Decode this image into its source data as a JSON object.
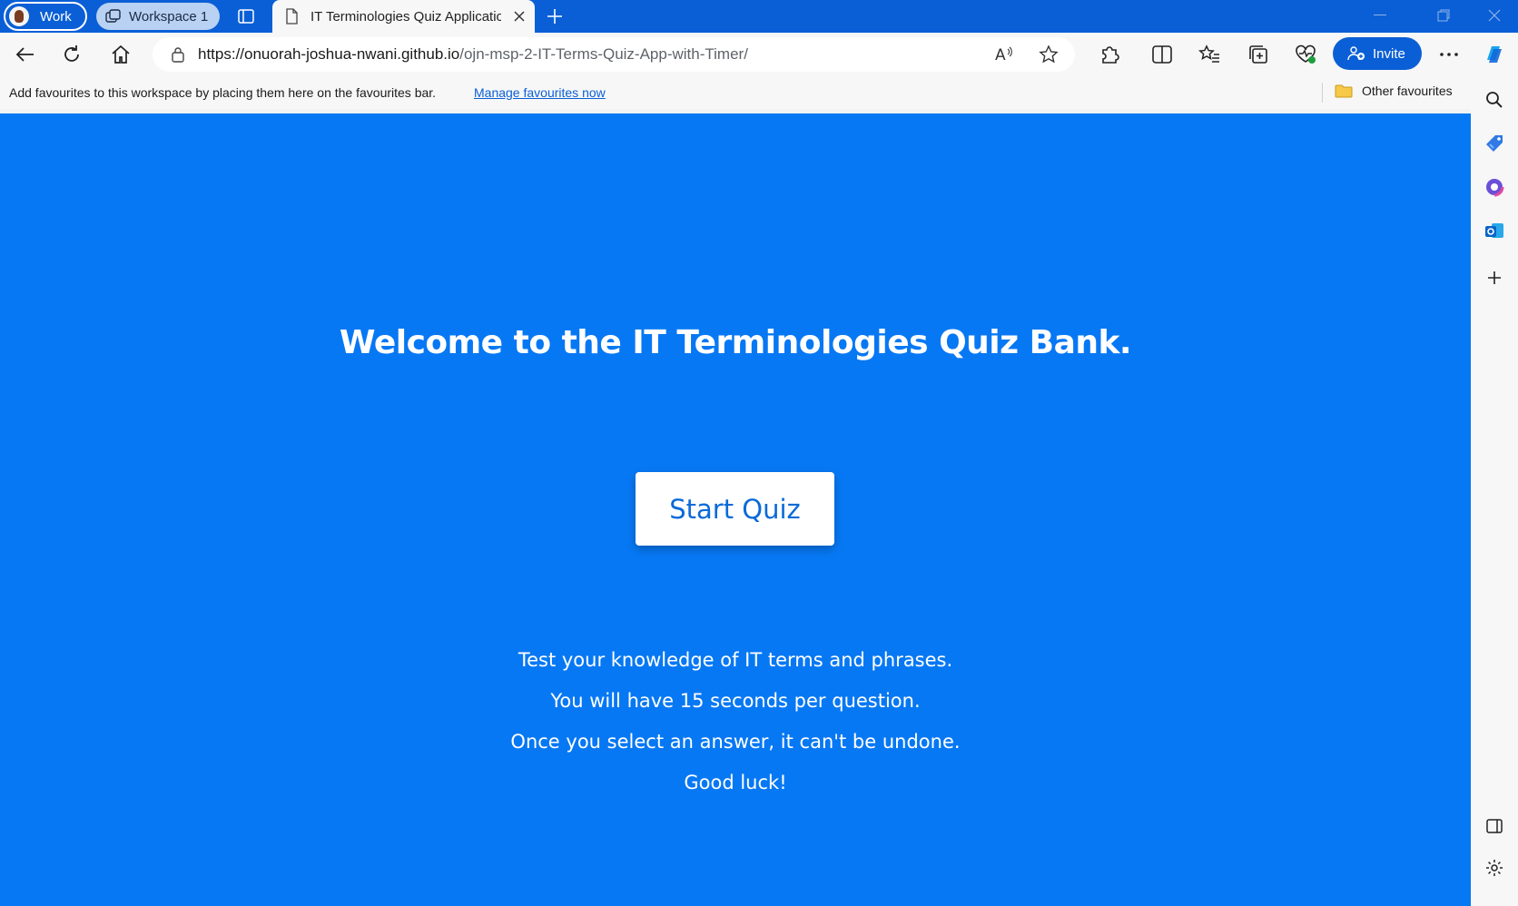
{
  "browser": {
    "profile_label": "Work",
    "workspace_label": "Workspace 1",
    "active_tab": {
      "title": "IT Terminologies Quiz Application"
    },
    "address": {
      "host": "https://onuorah-joshua-nwani.github.io",
      "path": "/ojn-msp-2-IT-Terms-Quiz-App-with-Timer/"
    },
    "invite_label": "Invite",
    "favourites_bar": {
      "message": "Add favourites to this workspace by placing them here on the favourites bar.",
      "manage_link": "Manage favourites now",
      "other_favourites": "Other favourites"
    },
    "accent_color": "#0a5fd6"
  },
  "page": {
    "background_color": "#0778f4",
    "heading": "Welcome to the IT Terminologies Quiz Bank.",
    "start_button_label": "Start Quiz",
    "rules": [
      "Test your knowledge of IT terms and phrases.",
      "You will have 15 seconds per question.",
      "Once you select an answer, it can't be undone.",
      "Good luck!"
    ]
  },
  "icons": {
    "titlebar": [
      "tab-actions-icon",
      "page-icon",
      "close-icon",
      "plus-icon",
      "minimize-icon",
      "restore-icon",
      "close-window-icon"
    ],
    "toolbar": [
      "back-icon",
      "refresh-icon",
      "home-icon",
      "lock-icon",
      "read-aloud-icon",
      "favorite-star-icon",
      "extensions-icon",
      "split-screen-icon",
      "favorites-icon",
      "collections-icon",
      "browser-essentials-icon",
      "more-icon",
      "copilot-icon"
    ],
    "sidebar": [
      "search-icon",
      "shopping-tag-icon",
      "office-icon",
      "outlook-icon",
      "add-icon",
      "sidebar-toggle-icon",
      "settings-icon"
    ]
  }
}
